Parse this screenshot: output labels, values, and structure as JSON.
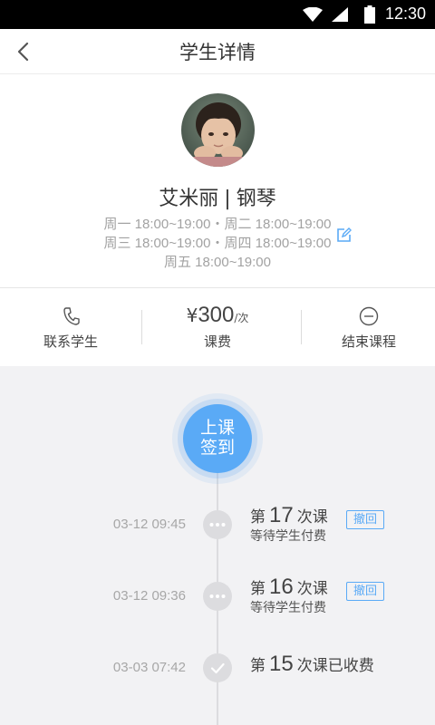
{
  "status_bar": {
    "time": "12:30"
  },
  "header": {
    "title": "学生详情"
  },
  "student": {
    "name": "艾米丽",
    "separator": "|",
    "course": "钢琴",
    "schedule": [
      "周一 18:00~19:00・周二 18:00~19:00",
      "周三 18:00~19:00・周四 18:00~19:00",
      "周五 18:00~19:00"
    ]
  },
  "actions": {
    "contact_label": "联系学生",
    "fee_currency": "¥",
    "fee_amount": "300",
    "fee_unit": "/次",
    "fee_label": "课费",
    "end_label": "结束课程"
  },
  "checkin": {
    "line1": "上课",
    "line2": "签到"
  },
  "timeline": [
    {
      "date": "03-12 09:45",
      "prefix": "第",
      "number": "17",
      "suffix": "次课",
      "status": "等待学生付费",
      "action": "撤回",
      "state": "pending"
    },
    {
      "date": "03-12 09:36",
      "prefix": "第",
      "number": "16",
      "suffix": "次课",
      "status": "等待学生付费",
      "action": "撤回",
      "state": "pending"
    },
    {
      "date": "03-03 07:42",
      "prefix": "第",
      "number": "15",
      "suffix": "次课已收费",
      "state": "paid"
    }
  ],
  "colors": {
    "accent": "#5aaaf6",
    "node": "#dcdcdf",
    "muted_text": "#a2a2a2"
  }
}
